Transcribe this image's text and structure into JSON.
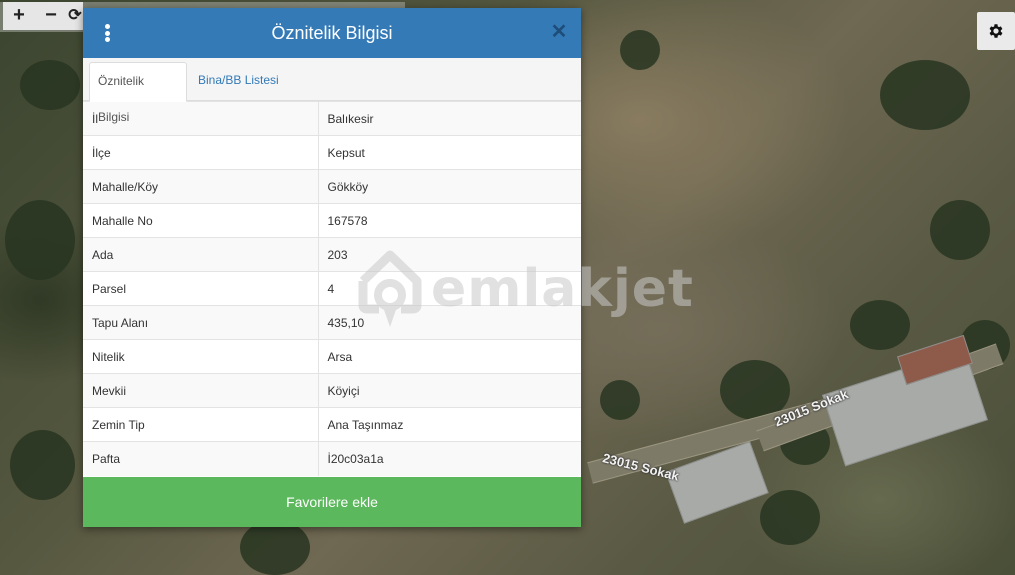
{
  "map": {
    "road_labels": [
      "23015 Sokak",
      "23015 Sokak"
    ]
  },
  "controls": {
    "zoom_in": "+",
    "zoom_out": "−",
    "rotate": "⟳"
  },
  "dialog": {
    "title": "Öznitelik Bilgisi",
    "close": "✕",
    "tabs": [
      {
        "label": "Öznitelik Bilgisi",
        "active": true
      },
      {
        "label": "Bina/BB Listesi",
        "active": false
      }
    ],
    "rows": [
      {
        "key": "İl",
        "value": "Balıkesir"
      },
      {
        "key": "İlçe",
        "value": "Kepsut"
      },
      {
        "key": "Mahalle/Köy",
        "value": "Gökköy"
      },
      {
        "key": "Mahalle No",
        "value": "167578"
      },
      {
        "key": "Ada",
        "value": "203"
      },
      {
        "key": "Parsel",
        "value": "4"
      },
      {
        "key": "Tapu Alanı",
        "value": "435,10"
      },
      {
        "key": "Nitelik",
        "value": "Arsa"
      },
      {
        "key": "Mevkii",
        "value": "Köyiçi"
      },
      {
        "key": "Zemin Tip",
        "value": "Ana Taşınmaz"
      },
      {
        "key": "Pafta",
        "value": "İ20c03a1a"
      }
    ],
    "add_favorite": "Favorilere ekle"
  },
  "watermark": {
    "text": "emlakjet"
  },
  "colors": {
    "header": "#337ab7",
    "button": "#5cb85c",
    "link": "#337ab7"
  },
  "icons": {
    "menu": "menu-icon",
    "close": "close-icon",
    "settings": "gear-icon",
    "watermark": "location-pin-icon"
  }
}
